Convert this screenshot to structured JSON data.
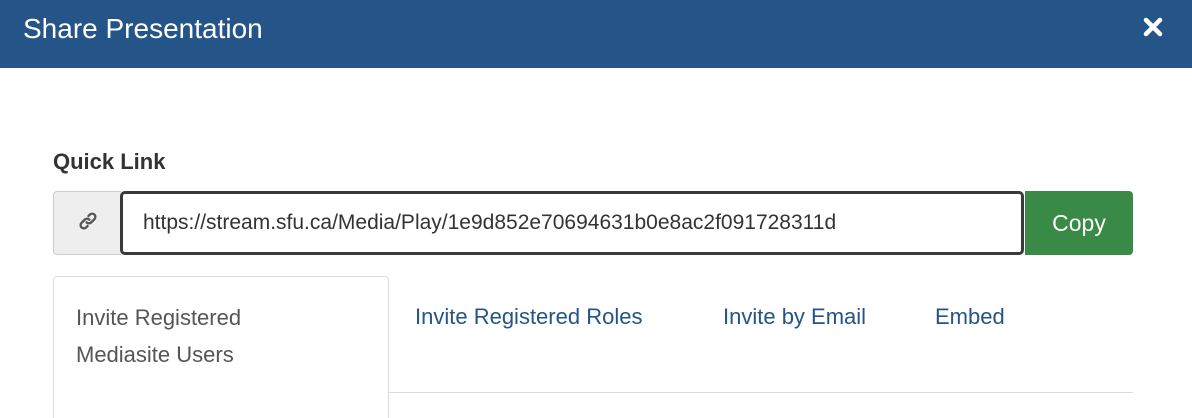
{
  "dialog": {
    "title": "Share Presentation",
    "close_icon": "close-icon"
  },
  "quick_link": {
    "label": "Quick Link",
    "icon": "link-icon",
    "url": "https://stream.sfu.ca/Media/Play/1e9d852e70694631b0e8ac2f091728311d",
    "copy_label": "Copy"
  },
  "tabs": [
    {
      "label_line1": "Invite Registered",
      "label_line2": "Mediasite Users",
      "active": true
    },
    {
      "label": "Invite Registered Roles",
      "active": false
    },
    {
      "label": "Invite by Email",
      "active": false
    },
    {
      "label": "Embed",
      "active": false
    }
  ],
  "colors": {
    "header": "#245488",
    "copy_button": "#3a8a47",
    "tab_link": "#245488"
  }
}
